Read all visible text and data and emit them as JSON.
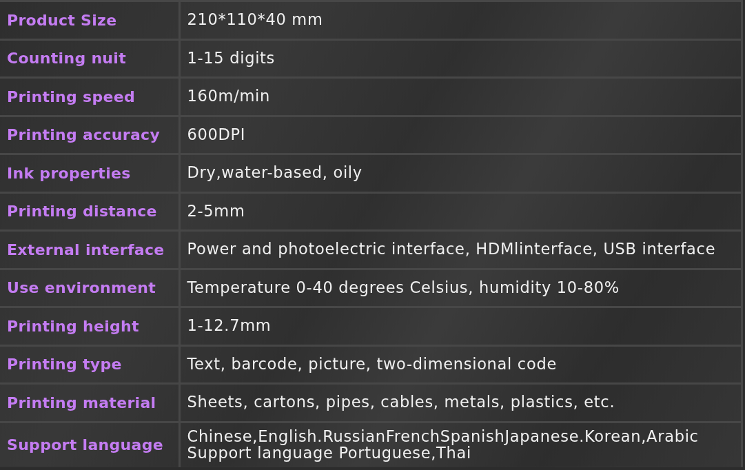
{
  "specs": [
    {
      "label": "Product Size",
      "value": "210*110*40 mm"
    },
    {
      "label": "Counting nuit",
      "value": "1-15 digits"
    },
    {
      "label": "Printing speed",
      "value": "160m/min"
    },
    {
      "label": "Printing accuracy",
      "value": "600DPI"
    },
    {
      "label": "Ink properties",
      "value": "Dry,water-based, oily"
    },
    {
      "label": "Printing distance",
      "value": "2-5mm"
    },
    {
      "label": "External interface",
      "value": "Power and photoelectric interface, HDMlinterface, USB interface"
    },
    {
      "label": "Use environment",
      "value": "Temperature 0-40 degrees Celsius, humidity 10-80%"
    },
    {
      "label": "Printing height",
      "value": "1-12.7mm"
    },
    {
      "label": "Printing type",
      "value": "Text, barcode, picture, two-dimensional code"
    },
    {
      "label": "Printing material",
      "value": "Sheets, cartons, pipes, cables, metals, plastics, etc."
    },
    {
      "label": "Support language",
      "value": "Chinese,English.RussianFrenchSpanishJapanese.Korean,Arabic Support language Portuguese,Thai"
    }
  ]
}
